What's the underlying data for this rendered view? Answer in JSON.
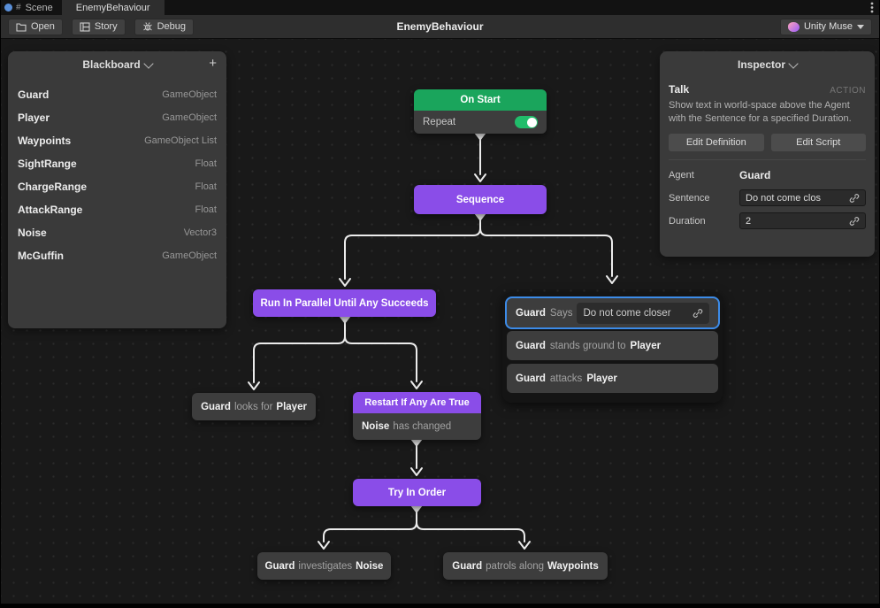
{
  "tabbar": {
    "scene_tab": "Scene",
    "graph_tab": "EnemyBehaviour"
  },
  "toolbar": {
    "open_label": "Open",
    "story_label": "Story",
    "debug_label": "Debug",
    "title": "EnemyBehaviour",
    "muse_label": "Unity Muse"
  },
  "blackboard": {
    "title": "Blackboard",
    "add_label": "+",
    "items": [
      {
        "name": "Guard",
        "type": "GameObject"
      },
      {
        "name": "Player",
        "type": "GameObject"
      },
      {
        "name": "Waypoints",
        "type": "GameObject List"
      },
      {
        "name": "SightRange",
        "type": "Float"
      },
      {
        "name": "ChargeRange",
        "type": "Float"
      },
      {
        "name": "AttackRange",
        "type": "Float"
      },
      {
        "name": "Noise",
        "type": "Vector3"
      },
      {
        "name": "McGuffin",
        "type": "GameObject"
      }
    ]
  },
  "inspector": {
    "title": "Inspector",
    "node_name": "Talk",
    "node_kind": "ACTION",
    "description": "Show text in world-space above the Agent with the Sentence for a specified Duration.",
    "edit_definition_label": "Edit Definition",
    "edit_script_label": "Edit Script",
    "agent_label": "Agent",
    "agent_value": "Guard",
    "sentence_label": "Sentence",
    "sentence_value": "Do not come clos",
    "duration_label": "Duration",
    "duration_value": "2"
  },
  "graph": {
    "on_start": {
      "title": "On Start",
      "repeat_label": "Repeat",
      "repeat_on": true
    },
    "sequence": {
      "title": "Sequence"
    },
    "run_parallel": {
      "title": "Run In Parallel Until Any Succeeds"
    },
    "says": {
      "agent": "Guard",
      "verb": "Says",
      "sentence": "Do not come closer"
    },
    "stands": {
      "agent": "Guard",
      "verb": "stands ground to",
      "target": "Player"
    },
    "attacks": {
      "agent": "Guard",
      "verb": "attacks",
      "target": "Player"
    },
    "looks": {
      "agent": "Guard",
      "verb": "looks for",
      "target": "Player"
    },
    "restart": {
      "title": "Restart If Any Are True",
      "cond_subject": "Noise",
      "cond_rest": "has changed"
    },
    "try_order": {
      "title": "Try In Order"
    },
    "investigates": {
      "agent": "Guard",
      "verb": "investigates",
      "target": "Noise"
    },
    "patrols": {
      "agent": "Guard",
      "verb": "patrols along",
      "target": "Waypoints"
    }
  },
  "colors": {
    "accent_purple": "#8a4de8",
    "accent_green": "#1aa55c",
    "selection_blue": "#3c8be8",
    "toggle_green": "#21bd6b",
    "panel_grey": "#3a3a3a",
    "canvas_dark": "#191919"
  }
}
